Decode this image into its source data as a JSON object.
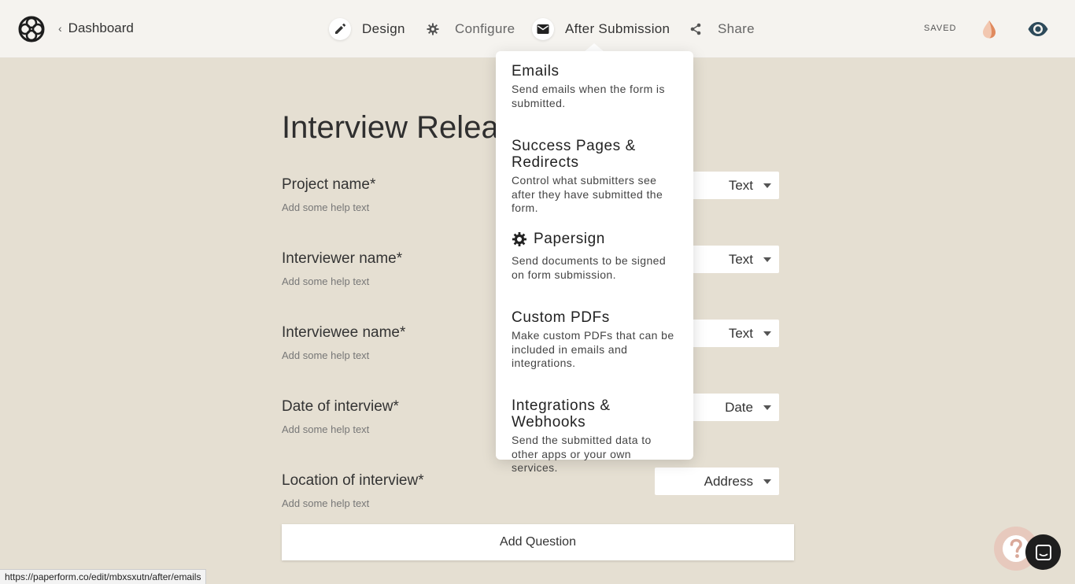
{
  "header": {
    "back_label": "Dashboard",
    "tabs": [
      {
        "label": "Design",
        "icon": "pencil-icon"
      },
      {
        "label": "Configure",
        "icon": "gear-icon"
      },
      {
        "label": "After Submission",
        "icon": "envelope-icon"
      },
      {
        "label": "Share",
        "icon": "share-icon"
      }
    ],
    "saved_label": "SAVED",
    "colors": {
      "accent_drop": "#e8a07a",
      "eye": "#2d4a5a"
    }
  },
  "form": {
    "title": "Interview Release",
    "questions": [
      {
        "label": "Project name*",
        "help": "Add some help text",
        "type": "Text"
      },
      {
        "label": "Interviewer name*",
        "help": "Add some help text",
        "type": "Text"
      },
      {
        "label": "Interviewee name*",
        "help": "Add some help text",
        "type": "Text"
      },
      {
        "label": "Date of interview*",
        "help": "Add some help text",
        "type": "Date"
      },
      {
        "label": "Location of interview*",
        "help": "Add some help text",
        "type": "Address"
      }
    ],
    "add_question_label": "Add Question"
  },
  "after_menu": {
    "items": [
      {
        "title": "Emails",
        "desc": "Send emails when the form is submitted."
      },
      {
        "title": "Success Pages & Redirects",
        "desc": "Control what submitters see after they have submitted the form."
      },
      {
        "title": "Papersign",
        "desc": "Send documents to be signed on form submission.",
        "icon": "papersign-icon"
      },
      {
        "title": "Custom PDFs",
        "desc": "Make custom PDFs that can be included in emails and integrations."
      },
      {
        "title": "Integrations & Webhooks",
        "desc": "Send the submitted data to other apps or your own services."
      }
    ]
  },
  "status_url": "https://paperform.co/edit/mbxsxutn/after/emails"
}
